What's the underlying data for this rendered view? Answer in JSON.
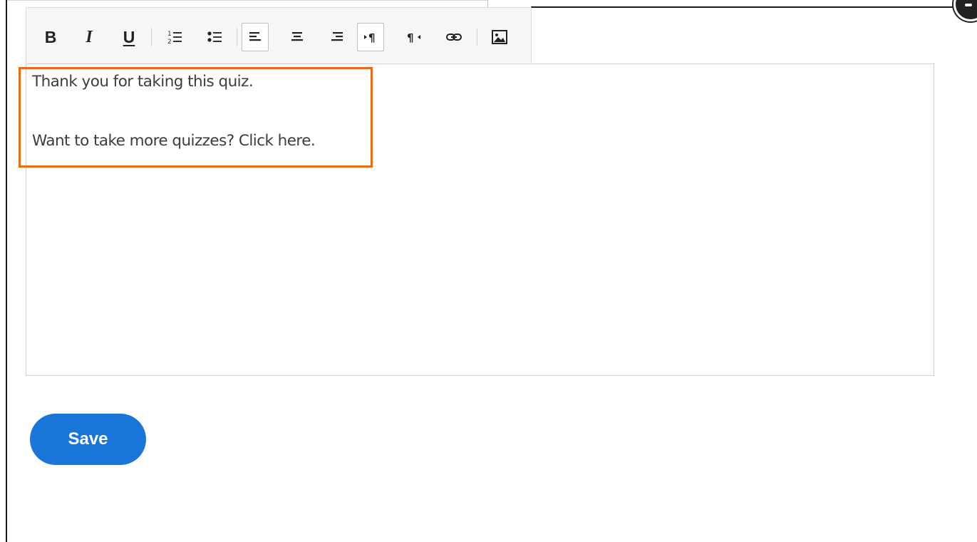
{
  "toolbar": {
    "buttons": [
      {
        "name": "bold",
        "icon": "bold-icon",
        "glyph": "B"
      },
      {
        "name": "italic",
        "icon": "italic-icon",
        "glyph": "I"
      },
      {
        "name": "underline",
        "icon": "underline-icon",
        "glyph": "U"
      },
      {
        "name": "ordered-list",
        "icon": "ordered-list-icon"
      },
      {
        "name": "unordered-list",
        "icon": "unordered-list-icon"
      },
      {
        "name": "align-left",
        "icon": "align-left-icon",
        "active": true
      },
      {
        "name": "align-center",
        "icon": "align-center-icon"
      },
      {
        "name": "align-right",
        "icon": "align-right-icon"
      },
      {
        "name": "ltr",
        "icon": "ltr-paragraph-icon",
        "active": true
      },
      {
        "name": "rtl",
        "icon": "rtl-paragraph-icon"
      },
      {
        "name": "link",
        "icon": "link-icon"
      },
      {
        "name": "image",
        "icon": "image-icon"
      }
    ]
  },
  "editor": {
    "lines": [
      "Thank you for taking this quiz.",
      "Want to take more quizzes? Click here."
    ]
  },
  "actions": {
    "save_label": "Save"
  },
  "colors": {
    "highlight": "#ee6a14",
    "save_button": "#1976d8"
  }
}
